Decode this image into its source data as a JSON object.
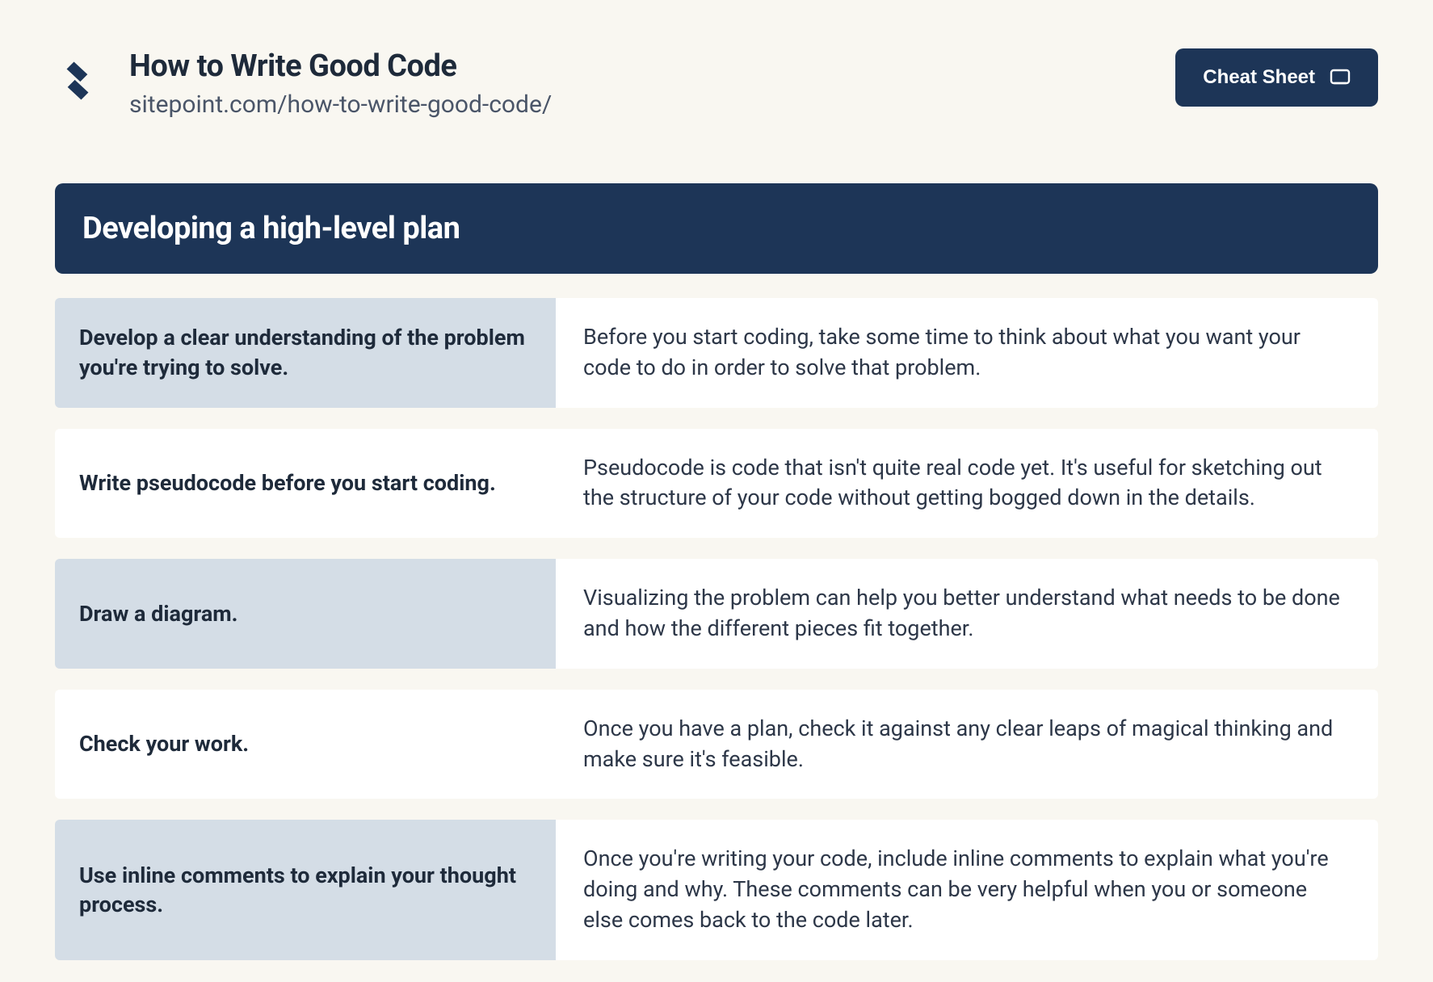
{
  "header": {
    "title": "How to Write Good Code",
    "url": "sitepoint.com/how-to-write-good-code/",
    "button_label": "Cheat Sheet"
  },
  "section": {
    "title": "Developing a high-level plan"
  },
  "rows": [
    {
      "left": "Develop a clear understanding of the problem you're trying to solve.",
      "right": "Before you start coding, take some time to think about what you want your code to do in order to solve that problem."
    },
    {
      "left": "Write pseudocode before you start coding.",
      "right": "Pseudocode is code that isn't quite real code yet. It's useful for sketching out the structure of your code without getting bogged down in the details."
    },
    {
      "left": "Draw a diagram.",
      "right": "Visualizing the problem can help you better understand what needs to be done and how the different pieces fit together."
    },
    {
      "left": "Check your work.",
      "right": "Once you have a plan, check it against any clear leaps of magical thinking and make sure it's feasible."
    },
    {
      "left": "Use inline comments to explain your thought process.",
      "right": "Once you're writing your code, include inline comments to explain what you're doing and why. These comments can be very helpful when you or someone else comes back to the code later."
    }
  ]
}
